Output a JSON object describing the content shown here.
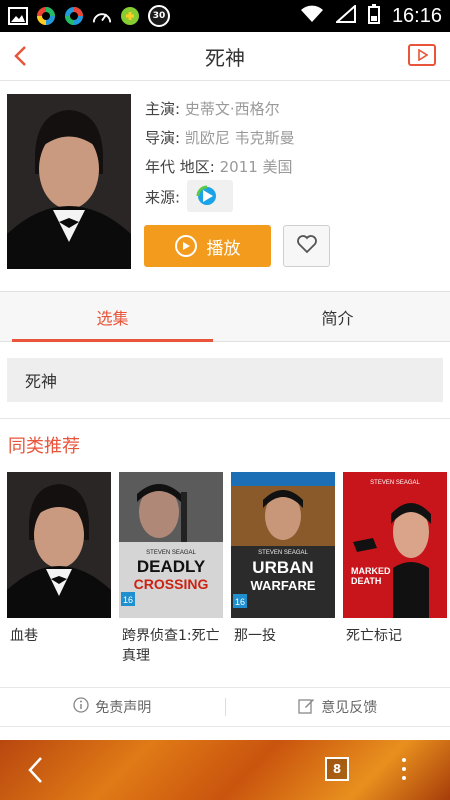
{
  "status_bar": {
    "time": "16:16",
    "badge": "30",
    "icons": [
      "gallery-icon",
      "app-icon-1",
      "app-icon-2",
      "speedometer-icon",
      "game-icon",
      "wifi-icon",
      "signal-icon",
      "battery-icon"
    ]
  },
  "header": {
    "title": "死神",
    "back_icon": "chevron-left-icon",
    "action_icon": "play-box-icon"
  },
  "movie": {
    "cast_label": "主演:",
    "cast_value": "史蒂文·西格尔",
    "director_label": "导演:",
    "director_value": "凯欧尼 韦克斯曼",
    "year_region_label": "年代 地区:",
    "year_region_value": "2011 美国",
    "source_label": "来源:",
    "play_label": "播放"
  },
  "tabs": [
    {
      "label": "选集",
      "active": true
    },
    {
      "label": "简介",
      "active": false
    }
  ],
  "episode_label": "死神",
  "recommend": {
    "title": "同类推荐",
    "items": [
      {
        "name": "血巷",
        "poster_text": []
      },
      {
        "name": "跨界侦查1:死亡真理",
        "poster_text": [
          "STEVEN SEAGAL",
          "DEADLY",
          "CROSSING",
          "16"
        ]
      },
      {
        "name": "那一投",
        "poster_text": [
          "STEVEN SEAGAL",
          "URBAN",
          "WARFARE",
          "16"
        ]
      },
      {
        "name": "死亡标记",
        "poster_text": [
          "STEVEN SEAGAL",
          "MARKED",
          "DEATH"
        ]
      }
    ]
  },
  "footer": {
    "disclaimer": "免责声明",
    "feedback": "意见反馈"
  },
  "navbar": {
    "tab_count": "8"
  },
  "colors": {
    "accent": "#e8553a",
    "play": "#f29b1c"
  }
}
